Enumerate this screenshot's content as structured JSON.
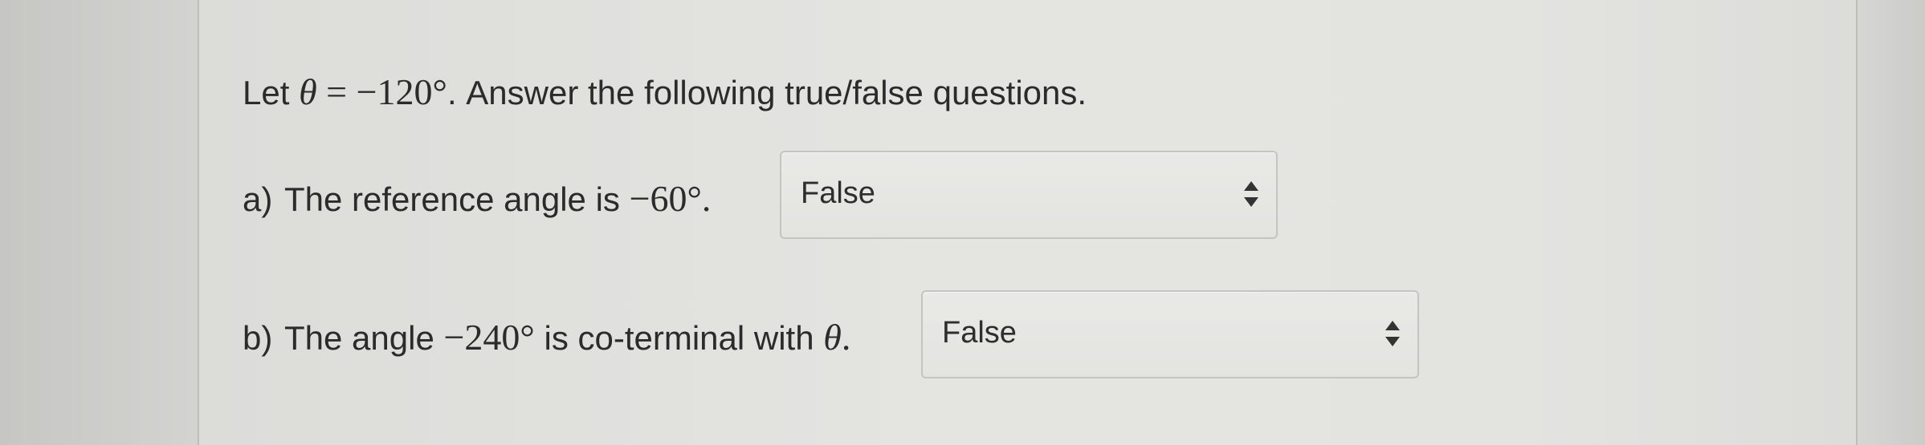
{
  "question": {
    "intro_prefix": "Let ",
    "theta": "θ",
    "intro_math": " = −120°",
    "intro_suffix": ". Answer the following true/false questions."
  },
  "parts": [
    {
      "label": "a)",
      "text_before": "The reference angle is ",
      "math": "−60°",
      "text_after": ".",
      "selected": "False"
    },
    {
      "label": "b)",
      "text_before": "The angle ",
      "math": "−240°",
      "text_middle": " is co-terminal with ",
      "theta": "θ",
      "text_after": ".",
      "selected": "False"
    }
  ],
  "icons": {
    "select_arrows": "up-down-arrows-icon"
  }
}
